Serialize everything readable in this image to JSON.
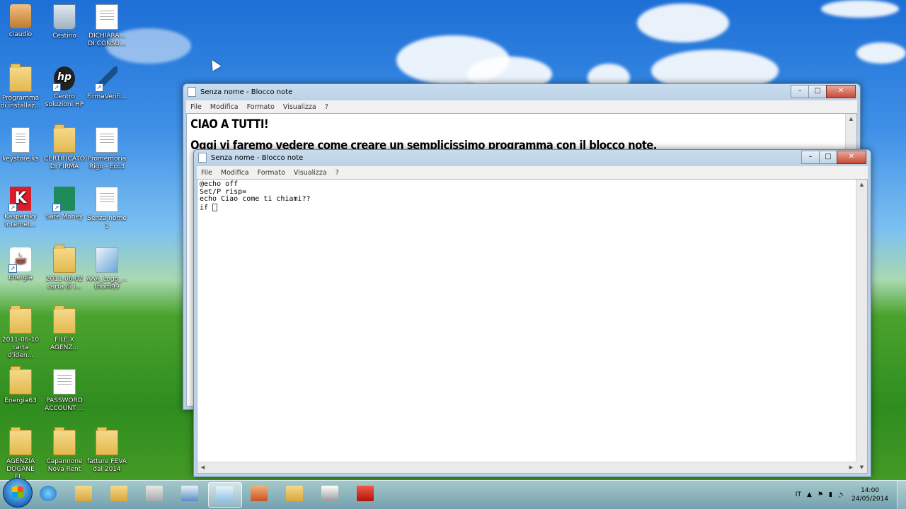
{
  "desktop": {
    "icons": [
      {
        "label": "claudio",
        "icon": "user-icon"
      },
      {
        "label": "Cestino",
        "icon": "recycle-bin-icon"
      },
      {
        "label": "DICHIARA... DI CONSU...",
        "icon": "document-icon"
      },
      {
        "label": "Programma di installaz...",
        "icon": "folder-icon"
      },
      {
        "label": "Centro soluzioni HP",
        "icon": "hp-icon"
      },
      {
        "label": "FirmaVerifi...",
        "icon": "pen-icon"
      },
      {
        "label": "keystore.ks",
        "icon": "file-icon"
      },
      {
        "label": "CERTIFICATO DI FIRMA",
        "icon": "folder-icon"
      },
      {
        "label": "Promemoria Rigo - Ecc3",
        "icon": "document-icon"
      },
      {
        "label": "Kaspersky Internet...",
        "icon": "kaspersky-icon"
      },
      {
        "label": "Safe Money",
        "icon": "money-icon"
      },
      {
        "label": "Senza nome 1",
        "icon": "document-icon"
      },
      {
        "label": "Energia",
        "icon": "java-icon"
      },
      {
        "label": "2011-06-02 carta di i...",
        "icon": "folder-icon"
      },
      {
        "label": "AAA_Logo_... thom99",
        "icon": "image-icon"
      },
      {
        "label": "2011-06-10 carta d'iden...",
        "icon": "folder-icon"
      },
      {
        "label": "FILE X AGENZ...",
        "icon": "folder-icon"
      },
      {
        "label": "Energia63",
        "icon": "folder-icon"
      },
      {
        "label": "PASSWORD ACCOUNT ...",
        "icon": "document-icon"
      },
      {
        "label": "AGENZIA DOGANE FI...",
        "icon": "folder-icon"
      },
      {
        "label": "Capannone Nova Rent",
        "icon": "folder-icon"
      },
      {
        "label": "fatture FEVA dal 2014",
        "icon": "folder-icon"
      }
    ]
  },
  "back_window": {
    "title": "Senza nome - Blocco note",
    "menu": [
      "File",
      "Modifica",
      "Formato",
      "Visualizza",
      "?"
    ],
    "lines": [
      "CIAO A TUTTI!",
      "Oggi vi faremo vedere come creare un semplicissimo programma con il blocco note."
    ]
  },
  "front_window": {
    "title": "Senza nome - Blocco note",
    "menu": [
      "File",
      "Modifica",
      "Formato",
      "Visualizza",
      "?"
    ],
    "text": "@echo off\nSet/P risp=\necho Ciao come ti chiami??\nif "
  },
  "taskbar": {
    "language": "IT",
    "time": "14:00",
    "date": "24/05/2014",
    "apps": [
      "internet-explorer-icon",
      "explorer-icon",
      "folder-icon",
      "documents-icon",
      "publisher-icon",
      "notepad-icon",
      "office-icon",
      "folder-icon",
      "archive-icon",
      "acrobat-icon"
    ]
  }
}
